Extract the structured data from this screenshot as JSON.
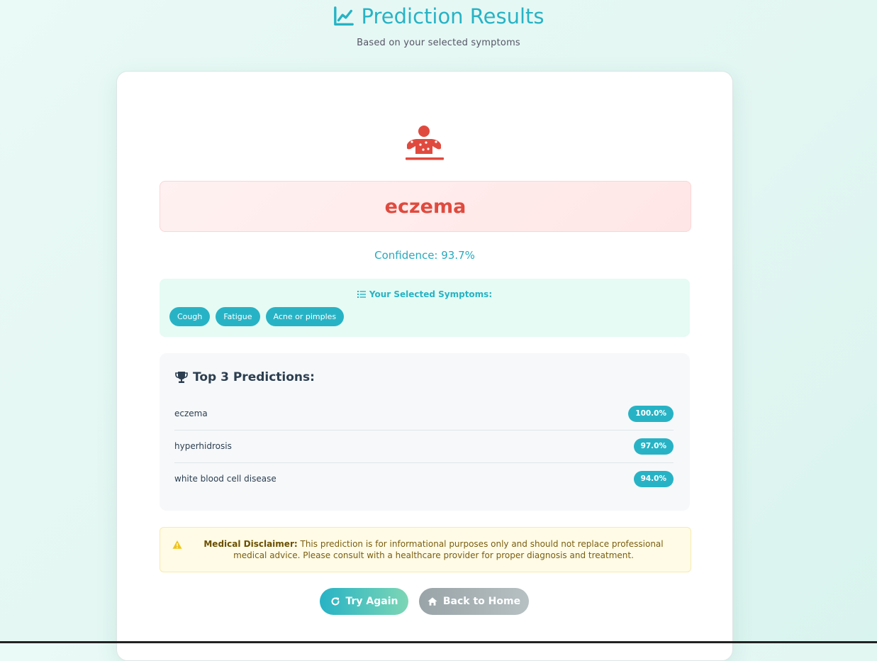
{
  "header": {
    "title": "Prediction Results",
    "subtitle": "Based on your selected symptoms",
    "title_icon": "chart-line-icon"
  },
  "result": {
    "icon": "patient-icon",
    "disease": "eczema",
    "confidence_text": "Confidence: 93.7%"
  },
  "symptoms": {
    "title": "Your Selected Symptoms:",
    "icon": "list-icon",
    "items": [
      "Cough",
      "Fatigue",
      "Acne or pimples"
    ]
  },
  "predictions": {
    "title": "Top 3 Predictions:",
    "icon": "trophy-icon",
    "items": [
      {
        "name": "eczema",
        "percent": "100.0%"
      },
      {
        "name": "hyperhidrosis",
        "percent": "97.0%"
      },
      {
        "name": "white blood cell disease",
        "percent": "94.0%"
      }
    ]
  },
  "disclaimer": {
    "icon": "warning-icon",
    "label": "Medical Disclaimer:",
    "text": " This prediction is for informational purposes only and should not replace professional medical advice. Please consult with a healthcare provider for proper diagnosis and treatment."
  },
  "actions": {
    "try_again": {
      "label": "Try Again",
      "icon": "redo-icon"
    },
    "back_home": {
      "label": "Back to Home",
      "icon": "home-icon"
    }
  },
  "colors": {
    "accent": "#27b3c5",
    "danger": "#e04a3e",
    "warning": "#f0c419"
  }
}
